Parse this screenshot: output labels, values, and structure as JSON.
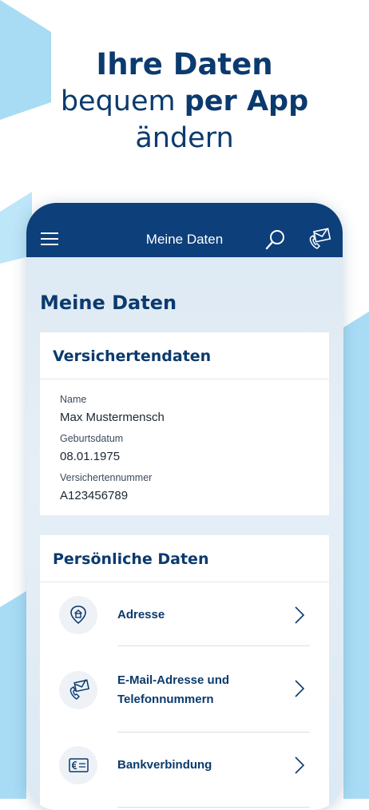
{
  "headline": {
    "line1": "Ihre Daten",
    "line2_normal": "bequem",
    "line2_bold": "per App",
    "line3": "ändern"
  },
  "appbar": {
    "title": "Meine Daten",
    "icons": [
      "menu-icon",
      "search-icon",
      "mail-phone-icon"
    ]
  },
  "page_title": "Meine Daten",
  "versichertendaten": {
    "heading": "Versichertendaten",
    "fields": [
      {
        "label": "Name",
        "value": "Max Mustermensch"
      },
      {
        "label": "Geburtsdatum",
        "value": "08.01.1975"
      },
      {
        "label": "Versichertennummer",
        "value": "A123456789"
      }
    ]
  },
  "persoenliche_daten": {
    "heading": "Persönliche Daten",
    "items": [
      {
        "label": "Adresse",
        "icon": "home-pin-icon"
      },
      {
        "label": "E-Mail-Adresse und",
        "label2": "Telefonnummern",
        "icon": "mail-phone-icon"
      },
      {
        "label": "Bankverbindung",
        "icon": "euro-card-icon"
      }
    ]
  },
  "colors": {
    "brand_navy": "#0d3f7a",
    "text_navy": "#0b3a6e",
    "accent_light_blue": "#a8dcf5"
  }
}
